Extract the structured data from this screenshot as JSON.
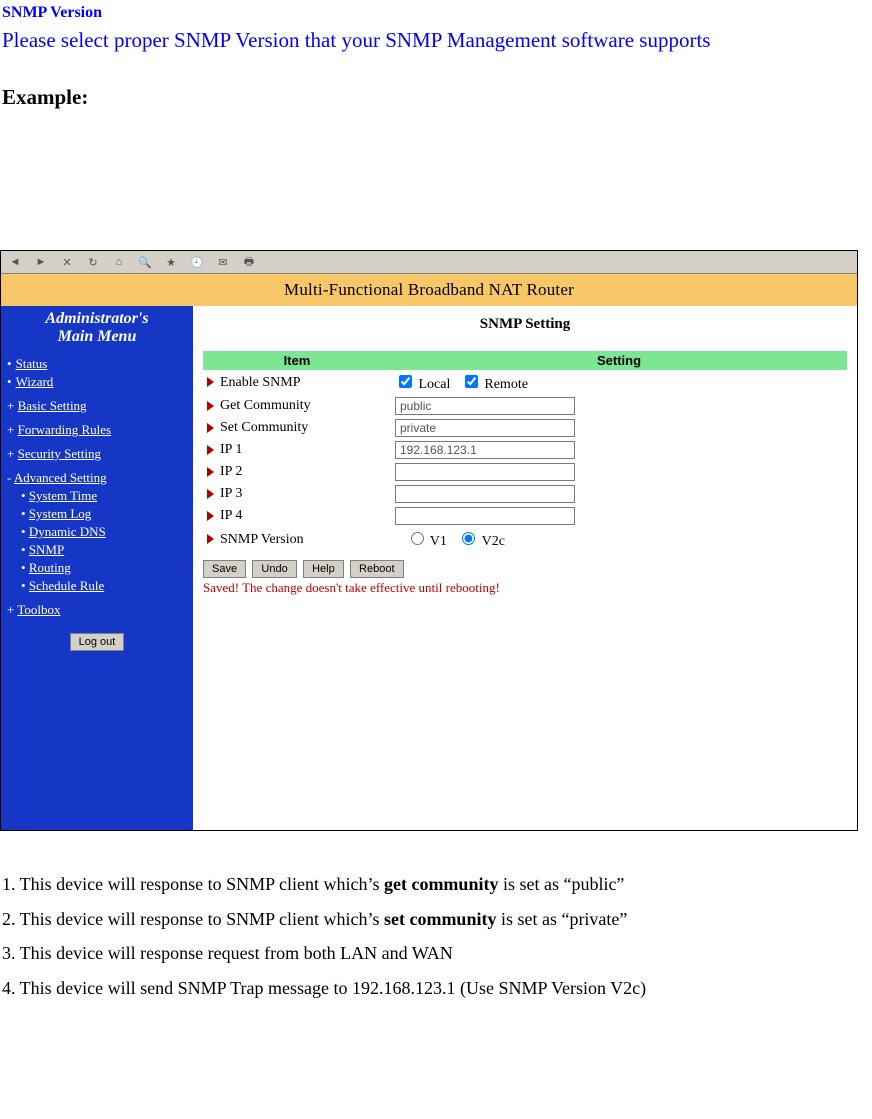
{
  "doc": {
    "heading": "SNMP Version",
    "desc": "Please select proper SNMP Version that your SNMP Management software supports",
    "example_label": "Example:",
    "notes": [
      {
        "pre": "1. This device will response to SNMP client which’s ",
        "bold": "get community",
        "post": " is set as “public”"
      },
      {
        "pre": "2. This device will response to SNMP client which’s ",
        "bold": "set community",
        "post": " is set as “private”"
      },
      {
        "pre": "3. This device will response request from both LAN and WAN",
        "bold": "",
        "post": ""
      },
      {
        "pre": "4. This device will send SNMP Trap message to 192.168.123.1 (Use SNMP Version V2c)",
        "bold": "",
        "post": ""
      }
    ]
  },
  "screenshot": {
    "toolbar_icons": [
      "back",
      "forward",
      "stop",
      "refresh",
      "home",
      "search",
      "favs",
      "mail",
      "print"
    ],
    "title_band": "Multi-Functional Broadband NAT Router",
    "sidebar": {
      "title_line1": "Administrator's",
      "title_line2": "Main Menu",
      "items": [
        {
          "kind": "bullet",
          "label": "Status"
        },
        {
          "kind": "bullet",
          "label": "Wizard"
        },
        {
          "kind": "plus",
          "label": "Basic Setting",
          "group": true
        },
        {
          "kind": "plus",
          "label": "Forwarding Rules",
          "group": true
        },
        {
          "kind": "plus",
          "label": "Security Setting",
          "group": true
        },
        {
          "kind": "minus",
          "label": "Advanced Setting",
          "group": true
        },
        {
          "kind": "sub",
          "label": "System Time"
        },
        {
          "kind": "sub",
          "label": "System Log"
        },
        {
          "kind": "sub",
          "label": "Dynamic DNS"
        },
        {
          "kind": "sub",
          "label": "SNMP"
        },
        {
          "kind": "sub",
          "label": "Routing"
        },
        {
          "kind": "sub",
          "label": "Schedule Rule"
        },
        {
          "kind": "plus",
          "label": "Toolbox",
          "group": true
        }
      ],
      "logout": "Log out"
    },
    "content": {
      "page_title": "SNMP Setting",
      "col_item": "Item",
      "col_setting": "Setting",
      "rows": {
        "enable_label": "Enable SNMP",
        "local_label": "Local",
        "remote_label": "Remote",
        "getc_label": "Get Community",
        "getc_value": "public",
        "setc_label": "Set Community",
        "setc_value": "private",
        "ip1_label": "IP 1",
        "ip1_value": "192.168.123.1",
        "ip2_label": "IP 2",
        "ip2_value": "",
        "ip3_label": "IP 3",
        "ip3_value": "",
        "ip4_label": "IP 4",
        "ip4_value": "",
        "ver_label": "SNMP Version",
        "v1_label": "V1",
        "v2_label": "V2c"
      },
      "buttons": {
        "save": "Save",
        "undo": "Undo",
        "help": "Help",
        "reboot": "Reboot"
      },
      "warn": "Saved! The change doesn't take effective until rebooting!"
    }
  }
}
